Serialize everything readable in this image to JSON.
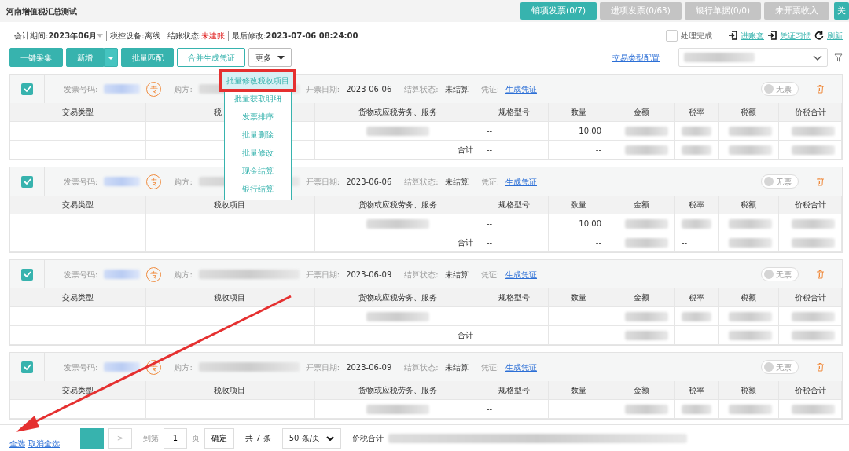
{
  "window": {
    "title": "河南增值税汇总测试"
  },
  "tabs": [
    {
      "label": "销项发票(0/7)",
      "selected": true
    },
    {
      "label": "进项发票(0/63)",
      "selected": false
    },
    {
      "label": "银行单据(0/0)",
      "selected": false
    },
    {
      "label": "未开票收入",
      "selected": false
    }
  ],
  "close_button": "关",
  "info_bar": [
    {
      "label": "会计期间:",
      "value": "2023年06月",
      "kind": "dropdown"
    },
    {
      "label": "税控设备:",
      "value": "离线",
      "kind": "plain"
    },
    {
      "label": "结账状态:",
      "value": "未建账",
      "kind": "alert"
    },
    {
      "label": "最后修改:",
      "value": "2023-07-06 08:24:00",
      "kind": "strong"
    }
  ],
  "done_checkbox": {
    "label": "处理完成",
    "checked": false
  },
  "header_links": [
    {
      "label": "进账套",
      "kind": "enter"
    },
    {
      "label": "凭证习惯",
      "kind": "enter"
    },
    {
      "label": "刷新",
      "kind": "refresh"
    }
  ],
  "toolbar": [
    {
      "label": "一键采集",
      "kind": "solid"
    },
    {
      "label": "新增",
      "kind": "split"
    },
    {
      "label": "批量匹配",
      "kind": "solid"
    },
    {
      "label": "合并生成凭证",
      "kind": "outline"
    },
    {
      "label": "更多",
      "kind": "menu"
    }
  ],
  "more_menu": [
    {
      "label": "批量修改税收项目",
      "selected": true
    },
    {
      "label": "批量获取明细",
      "selected": false
    },
    {
      "label": "发票排序",
      "selected": false
    },
    {
      "label": "批量删除",
      "selected": false
    },
    {
      "label": "批量修改",
      "selected": false
    },
    {
      "label": "现金结算",
      "selected": false
    },
    {
      "label": "银行结算",
      "selected": false
    }
  ],
  "type_config_link": "交易类型配置",
  "invoices": [
    {
      "checked": true,
      "number_label": "发票号码:",
      "type_badge": "专",
      "buyer_label": "购方:",
      "date_label": "开票日期:",
      "date": "2023-06-06",
      "settle_label": "结算状态:",
      "settle_status": "未结算",
      "voucher_label": "凭证:",
      "voucher_link": "生成凭证",
      "toggle_label": "无票",
      "toggle_on": false,
      "columns": [
        "交易类型",
        "税",
        "货物或应税劳务、服务",
        "规格型号",
        "数量",
        "金额",
        "税率",
        "税额",
        "价税合计"
      ],
      "rows": [
        {
          "cells": [
            {},
            {},
            {
              "redacted": true
            },
            {
              "text": "--"
            },
            {
              "text": "10.00"
            },
            {
              "redacted": true
            },
            {
              "redacted": true
            },
            {
              "redacted": true
            },
            {
              "redacted": true
            }
          ]
        },
        {
          "cells": [
            {},
            {},
            {
              "text": "合计"
            },
            {
              "text": "--"
            },
            {
              "text": "--"
            },
            {
              "redacted": true
            },
            {
              "redacted": true
            },
            {
              "redacted": true
            },
            {
              "redacted": true
            }
          ]
        }
      ]
    },
    {
      "checked": true,
      "number_label": "发票号码:",
      "type_badge": "专",
      "buyer_label": "购方:",
      "date_label": "开票日期:",
      "date": "2023-06-06",
      "settle_label": "结算状态:",
      "settle_status": "未结算",
      "voucher_label": "凭证:",
      "voucher_link": "生成凭证",
      "toggle_label": "无票",
      "toggle_on": false,
      "columns": [
        "交易类型",
        "税收项目",
        "货物或应税劳务、服务",
        "规格型号",
        "数量",
        "金额",
        "税率",
        "税额",
        "价税合计"
      ],
      "rows": [
        {
          "cells": [
            {},
            {},
            {
              "redacted": true
            },
            {
              "text": "--"
            },
            {
              "text": "10.00"
            },
            {
              "redacted": true
            },
            {
              "redacted": true
            },
            {
              "redacted": true
            },
            {
              "redacted": true
            }
          ]
        },
        {
          "cells": [
            {},
            {},
            {
              "text": "合计"
            },
            {
              "text": "--"
            },
            {
              "text": "--"
            },
            {
              "redacted": true
            },
            {
              "text": "--"
            },
            {
              "redacted": true
            },
            {
              "redacted": true
            }
          ]
        }
      ]
    },
    {
      "checked": true,
      "number_label": "发票号码:",
      "type_badge": "专",
      "buyer_label": "购方:",
      "date_label": "开票日期:",
      "date": "2023-06-09",
      "settle_label": "结算状态:",
      "settle_status": "未结算",
      "voucher_label": "凭证:",
      "voucher_link": "生成凭证",
      "toggle_label": "无票",
      "toggle_on": false,
      "columns": [
        "交易类型",
        "税收项目",
        "货物或应税劳务、服务",
        "规格型号",
        "数量",
        "金额",
        "税率",
        "税额",
        "价税合计"
      ],
      "rows": [
        {
          "cells": [
            {},
            {},
            {
              "redacted": true
            },
            {
              "text": "--"
            },
            {},
            {
              "redacted": true
            },
            {
              "redacted": true
            },
            {
              "redacted": true
            },
            {
              "redacted": true
            }
          ]
        },
        {
          "cells": [
            {},
            {},
            {
              "text": "合计"
            },
            {
              "text": "--"
            },
            {
              "text": "--"
            },
            {
              "redacted": true
            },
            {},
            {
              "redacted": true
            },
            {
              "redacted": true
            }
          ]
        }
      ]
    },
    {
      "checked": true,
      "number_label": "发票号码:",
      "type_badge": "专",
      "buyer_label": "购方:",
      "date_label": "开票日期:",
      "date": "2023-06-09",
      "settle_label": "结算状态:",
      "settle_status": "未结算",
      "voucher_label": "凭证:",
      "voucher_link": "生成凭证",
      "toggle_label": "无票",
      "toggle_on": false,
      "columns": [
        "交易类型",
        "税收项目",
        "货物或应税劳务、服务",
        "规格型号",
        "数量",
        "金额",
        "税率",
        "税额",
        "价税合计"
      ],
      "rows": [
        {
          "cells": [
            {},
            {},
            {
              "redacted": true
            },
            {
              "text": "--"
            },
            {},
            {
              "redacted": true
            },
            {
              "redacted": true
            },
            {
              "redacted": true
            },
            {
              "redacted": true
            }
          ]
        }
      ]
    }
  ],
  "footer": {
    "select_all": "全选",
    "deselect_all": "取消全选",
    "next": ">",
    "goto_label": "到第",
    "page_value": "1",
    "page_suffix": "页",
    "confirm": "确定",
    "total": "共 7 条",
    "page_size": "50 条/页",
    "sum_label": "价税合计"
  }
}
